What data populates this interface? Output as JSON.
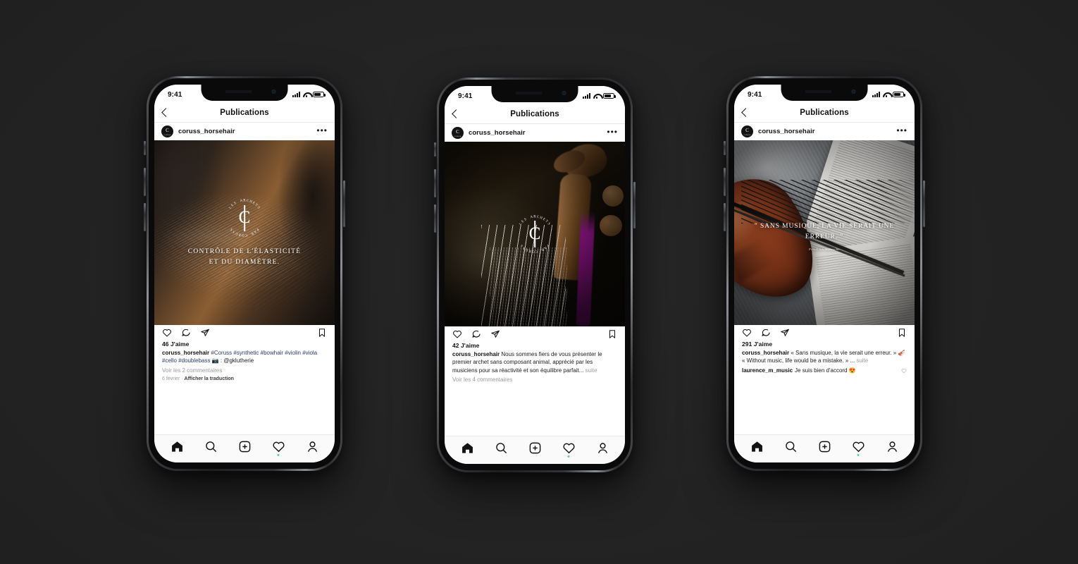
{
  "background_color": "#232323",
  "device": {
    "status_bar": {
      "time": "9:41",
      "signal_icon": "cellular-bars-icon",
      "wifi_icon": "wifi-icon",
      "battery_icon": "battery-icon"
    },
    "nav": {
      "back_icon": "chevron-left-icon",
      "title": "Publications"
    }
  },
  "tabbar": {
    "items": [
      {
        "name": "home",
        "icon": "home-icon",
        "active": true
      },
      {
        "name": "search",
        "icon": "search-icon",
        "active": false
      },
      {
        "name": "create",
        "icon": "plus-square-icon",
        "active": false
      },
      {
        "name": "activity",
        "icon": "heart-icon",
        "active": false,
        "badge_dot": true
      },
      {
        "name": "profile",
        "icon": "person-icon",
        "active": false
      }
    ]
  },
  "action_icons": {
    "like": "heart-icon",
    "comment": "speech-bubble-icon",
    "share": "paper-plane-icon",
    "save": "bookmark-icon"
  },
  "posts": [
    {
      "username": "coruss_horsehair",
      "avatar": "coruss-logo-avatar",
      "more_icon": "ellipsis-icon",
      "likes": "46 J'aime",
      "caption_user": "coruss_horsehair",
      "caption_tags": "#Coruss #synthetic #bowhair #violin #viola #cello #doublebass",
      "caption_tail": "📷 : @gklutherie",
      "comments_link": "Voir les 2 commentaires",
      "date": "6 février",
      "translate_label": "Afficher la traduction",
      "image": {
        "kind": "horsehair-macro",
        "logo_circle_top": "LES ARCHETS",
        "logo_circle_bottom": "PAR CORUSS",
        "logo_glyph": "C",
        "overlay_title": "CONTRÔLE DE L'ÉLASTICITÉ ET DU DIAMÈTRE."
      }
    },
    {
      "username": "coruss_horsehair",
      "avatar": "coruss-logo-avatar",
      "more_icon": "ellipsis-icon",
      "likes": "42 J'aime",
      "caption_user": "coruss_horsehair",
      "caption_body": "Nous sommes fiers de vous présenter le premier archet sans composant animal, apprécié par les musiciens pour sa réactivité et son équilibre parfait...",
      "caption_more": "suite",
      "comments_link": "Voir les 4 commentaires",
      "image": {
        "kind": "violin-scroll-dark",
        "logo_circle_top": "LES ARCHETS",
        "logo_circle_bottom": "PAR CORUSS",
        "logo_glyph": "C"
      }
    },
    {
      "username": "coruss_horsehair",
      "avatar": "coruss-logo-avatar",
      "more_icon": "ellipsis-icon",
      "likes": "291 J'aime",
      "caption_user": "coruss_horsehair",
      "caption_body": "« Sans musique, la vie serait une erreur. » 🎻",
      "caption_body2": "« Without music, life would be a mistake. » ...",
      "caption_more": "suite",
      "comment_user": "laurence_m_music",
      "comment_text": "Je suis bien d'accord 😍",
      "comment_like_icon": "heart-icon",
      "image": {
        "kind": "violin-sheet-music",
        "overlay_quote": "\" SANS MUSIQUE, LA VIE SERAIT UNE ERREUR. \"",
        "overlay_attribution": "Friedrich Nietzsche"
      }
    }
  ]
}
